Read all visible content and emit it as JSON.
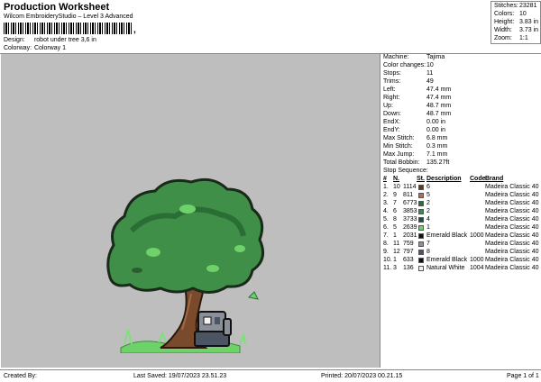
{
  "header": {
    "title": "Production Worksheet",
    "subtitle": "Wilcom EmbroideryStudio – Level 3 Advanced",
    "barcode_mark": ",",
    "design_label": "Design:",
    "design_value": "robot under tree 3,6 in",
    "colorway_label": "Colorway:",
    "colorway_value": "Colorway 1"
  },
  "stats": [
    {
      "label": "Stitches:",
      "value": "23281"
    },
    {
      "label": "Colors:",
      "value": "10"
    },
    {
      "label": "Height:",
      "value": "3.83 in"
    },
    {
      "label": "Width:",
      "value": "3.73 in"
    },
    {
      "label": "Zoom:",
      "value": "1:1"
    }
  ],
  "info": [
    {
      "label": "Machine:",
      "value": "Tajima"
    },
    {
      "label": "Color changes:",
      "value": "10"
    },
    {
      "label": "Stops:",
      "value": "11"
    },
    {
      "label": "Trims:",
      "value": "49"
    },
    {
      "label": "Left:",
      "value": "47.4 mm"
    },
    {
      "label": "Right:",
      "value": "47.4 mm"
    },
    {
      "label": "Up:",
      "value": "48.7 mm"
    },
    {
      "label": "Down:",
      "value": "48.7 mm"
    },
    {
      "label": "EndX:",
      "value": "0.00 in"
    },
    {
      "label": "EndY:",
      "value": "0.00 in"
    },
    {
      "label": "Max Stitch:",
      "value": "6.8 mm"
    },
    {
      "label": "Min Stitch:",
      "value": "0.3 mm"
    },
    {
      "label": "Max Jump:",
      "value": "7.1 mm"
    },
    {
      "label": "Total Bobbin:",
      "value": "135.27ft"
    }
  ],
  "stop_sequence": {
    "title": "Stop Sequence:",
    "headers": [
      "#",
      "N.",
      "St.",
      "Description",
      "Code",
      "Brand"
    ],
    "rows": [
      {
        "num": "1.",
        "n": "10",
        "st": "1114",
        "color": "#5a3a22",
        "desc": "6",
        "code": "",
        "brand": "Madeira Classic 40"
      },
      {
        "num": "2.",
        "n": "9",
        "st": "811",
        "color": "#b06a5a",
        "desc": "5",
        "code": "",
        "brand": "Madeira Classic 40"
      },
      {
        "num": "3.",
        "n": "7",
        "st": "6773",
        "color": "#2e6b3c",
        "desc": "2",
        "code": "",
        "brand": "Madeira Classic 40"
      },
      {
        "num": "4.",
        "n": "6",
        "st": "3853",
        "color": "#3d8a4a",
        "desc": "2",
        "code": "",
        "brand": "Madeira Classic 40"
      },
      {
        "num": "5.",
        "n": "8",
        "st": "3733",
        "color": "#1f4f3a",
        "desc": "4",
        "code": "",
        "brand": "Madeira Classic 40"
      },
      {
        "num": "6.",
        "n": "5",
        "st": "2639",
        "color": "#6fd16a",
        "desc": "1",
        "code": "",
        "brand": "Madeira Classic 40"
      },
      {
        "num": "7.",
        "n": "1",
        "st": "2031",
        "color": "#111111",
        "desc": "Emerald Black",
        "code": "1000",
        "brand": "Madeira Classic 40"
      },
      {
        "num": "8.",
        "n": "11",
        "st": "759",
        "color": "#8a8f98",
        "desc": "7",
        "code": "",
        "brand": "Madeira Classic 40"
      },
      {
        "num": "9.",
        "n": "12",
        "st": "797",
        "color": "#4b5563",
        "desc": "8",
        "code": "",
        "brand": "Madeira Classic 40"
      },
      {
        "num": "10.",
        "n": "1",
        "st": "633",
        "color": "#111111",
        "desc": "Emerald Black",
        "code": "1000",
        "brand": "Madeira Classic 40"
      },
      {
        "num": "11.",
        "n": "3",
        "st": "136",
        "color": "#f2f2f2",
        "desc": "Natural White",
        "code": "1004",
        "brand": "Madeira Classic 40"
      }
    ]
  },
  "footer": {
    "created_by": "Created By:",
    "last_saved": "Last Saved: 19/07/2023 23.51.23",
    "printed": "Printed: 20/07/2023 00.21.15",
    "page": "Page 1 of 1"
  },
  "colors": {
    "canvas_bg": "#bebebe",
    "foliage": "#3f8f48",
    "trunk": "#7a4a2c",
    "grass": "#6fd16a",
    "robot": "#8a8f98"
  }
}
